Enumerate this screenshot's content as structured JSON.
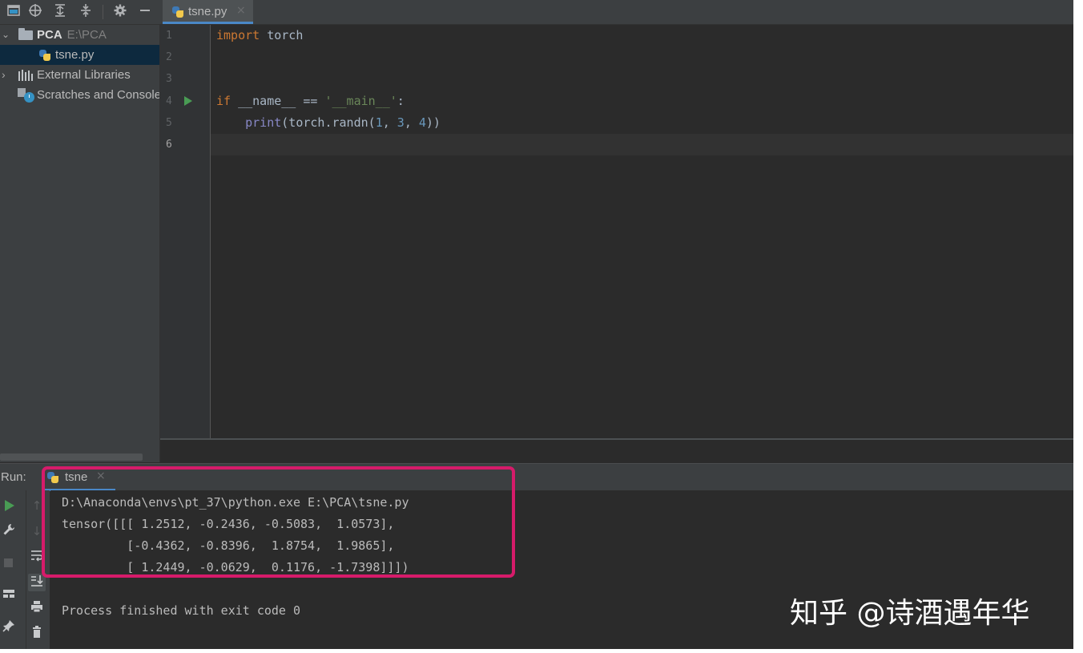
{
  "project_toolbar": {
    "icons": [
      "project-view-icon",
      "locate-icon",
      "expand-all-icon",
      "collapse-all-icon",
      "gear-icon",
      "hide-icon"
    ]
  },
  "editor_tab": {
    "label": "tsne.py",
    "close": "×"
  },
  "project_tree": {
    "items": [
      {
        "name": "PCA",
        "path": "E:\\PCA"
      },
      {
        "name": "tsne.py"
      },
      {
        "name": "External Libraries"
      },
      {
        "name": "Scratches and Consoles"
      }
    ]
  },
  "editor": {
    "line_numbers": [
      "1",
      "2",
      "3",
      "4",
      "5",
      "6"
    ],
    "code": {
      "l1_kw": "import",
      "l1_rest": " torch",
      "l4_kw": "if",
      "l4_mid": " __name__ == ",
      "l4_str": "'__main__'",
      "l4_end": ":",
      "l5_indent": "    ",
      "l5_print": "print",
      "l5_a": "(torch.randn(",
      "l5_n1": "1",
      "l5_c1": ", ",
      "l5_n2": "3",
      "l5_c2": ", ",
      "l5_n3": "4",
      "l5_end": "))"
    }
  },
  "run_panel": {
    "label": "Run:",
    "tab_label": "tsne",
    "tab_close": "×",
    "console_lines": [
      "D:\\Anaconda\\envs\\pt_37\\python.exe E:\\PCA\\tsne.py",
      "tensor([[[ 1.2512, -0.2436, -0.5083,  1.0573],",
      "         [-0.4362, -0.8396,  1.8754,  1.9865],",
      "         [ 1.2449, -0.0629,  0.1176, -1.7398]]])",
      "",
      "Process finished with exit code 0"
    ]
  },
  "watermark": "知乎 @诗酒遇年华",
  "colors": {
    "highlight_border": "#d61b6a",
    "accent": "#4a88c7",
    "run_green": "#499c54",
    "keyword": "#cc7832",
    "string": "#6a8759",
    "number": "#6897bb"
  }
}
